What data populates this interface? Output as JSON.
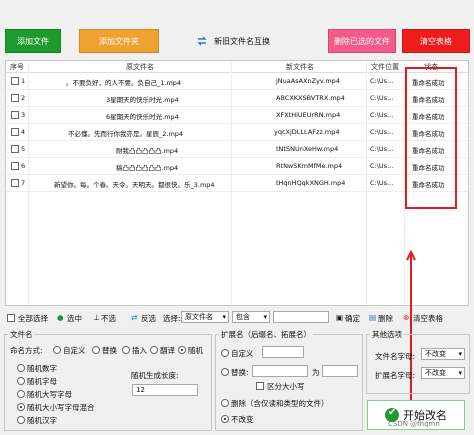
{
  "toolbar": {
    "add_file": "添加文件",
    "add_folder": "添加文件夹",
    "swap_names": "新旧文件名互换",
    "remove_selected": "删除已选的文件",
    "clear_list": "清空表格"
  },
  "table": {
    "headers": [
      "序号",
      "原文件名",
      "新文件名",
      "文件位置",
      "状态"
    ],
    "rows": [
      {
        "num": "1",
        "orig": "。不要负好，的人不要。负自己_1.mp4",
        "new": "jNuaAsAXnZyv.mp4",
        "loc": "C:\\Us...",
        "status": "重命名成功"
      },
      {
        "num": "2",
        "orig": "3星期天的快乐时光.mp4",
        "new": "ABCXKXSBVTRX.mp4",
        "loc": "C:\\Us...",
        "status": "重命名成功"
      },
      {
        "num": "3",
        "orig": "6星期天的快乐时光.mp4",
        "new": "XFXtHiUEUrRN.mp4",
        "loc": "C:\\Us...",
        "status": "重命名成功"
      },
      {
        "num": "4",
        "orig": "不必懂。先而行你我亦是。星辰_2.mp4",
        "new": "yqcXjDLLLAFzz.mp4",
        "loc": "C:\\Us...",
        "status": "重命名成功"
      },
      {
        "num": "5",
        "orig": "耐我凸凸凸凸凸.mp4",
        "new": "tNtSNUnXeHw.mp4",
        "loc": "C:\\Us...",
        "status": "重命名成功"
      },
      {
        "num": "6",
        "orig": "稿凸凸凸凸凸凸.mp4",
        "new": "RtNwSKmMfMe.mp4",
        "loc": "C:\\Us...",
        "status": "重命名成功"
      },
      {
        "num": "7",
        "orig": "新望你。每。个春。天令。天明天。都很快。乐_3.mp4",
        "new": "tHqnHQqkXNGH.mp4",
        "loc": "C:\\Us...",
        "status": "重命名成功"
      }
    ]
  },
  "selectbar": {
    "select_all": "全部选择",
    "select": "选中",
    "unselect": "不选",
    "invert": "反选",
    "choose": "选择:",
    "field": "原文件名",
    "mode": "包含",
    "confirm": "确定",
    "delete": "删除",
    "clear": "清空表格"
  },
  "filename": {
    "title": "文件名",
    "naming_label": "命名方式:",
    "custom": "自定义",
    "replace": "替换",
    "insert": "插入",
    "translate": "翻译",
    "random": "随机",
    "r_digits": "随机数字",
    "r_letters": "随机字母",
    "r_upper": "随机大写字母",
    "r_mixed": "随机大小写字母混合",
    "r_chinese": "随机汉字",
    "length_label": "随机生成长度:",
    "length_value": "12"
  },
  "ext": {
    "title": "扩展名（后缀名、拓展名）",
    "custom": "自定义",
    "replace": "替换:",
    "for": "为",
    "case_sensitive": "区分大小写",
    "delete": "删除（含仅读和类型的文件）",
    "unchanged": "不改变"
  },
  "other": {
    "title": "其他选项",
    "fname_case_label": "文件名字母:",
    "fname_case": "不改变",
    "ext_case_label": "扩展名字母:",
    "ext_case": "不改变"
  },
  "start_button": "开始改名",
  "watermark": "CSDN @fhqmn"
}
